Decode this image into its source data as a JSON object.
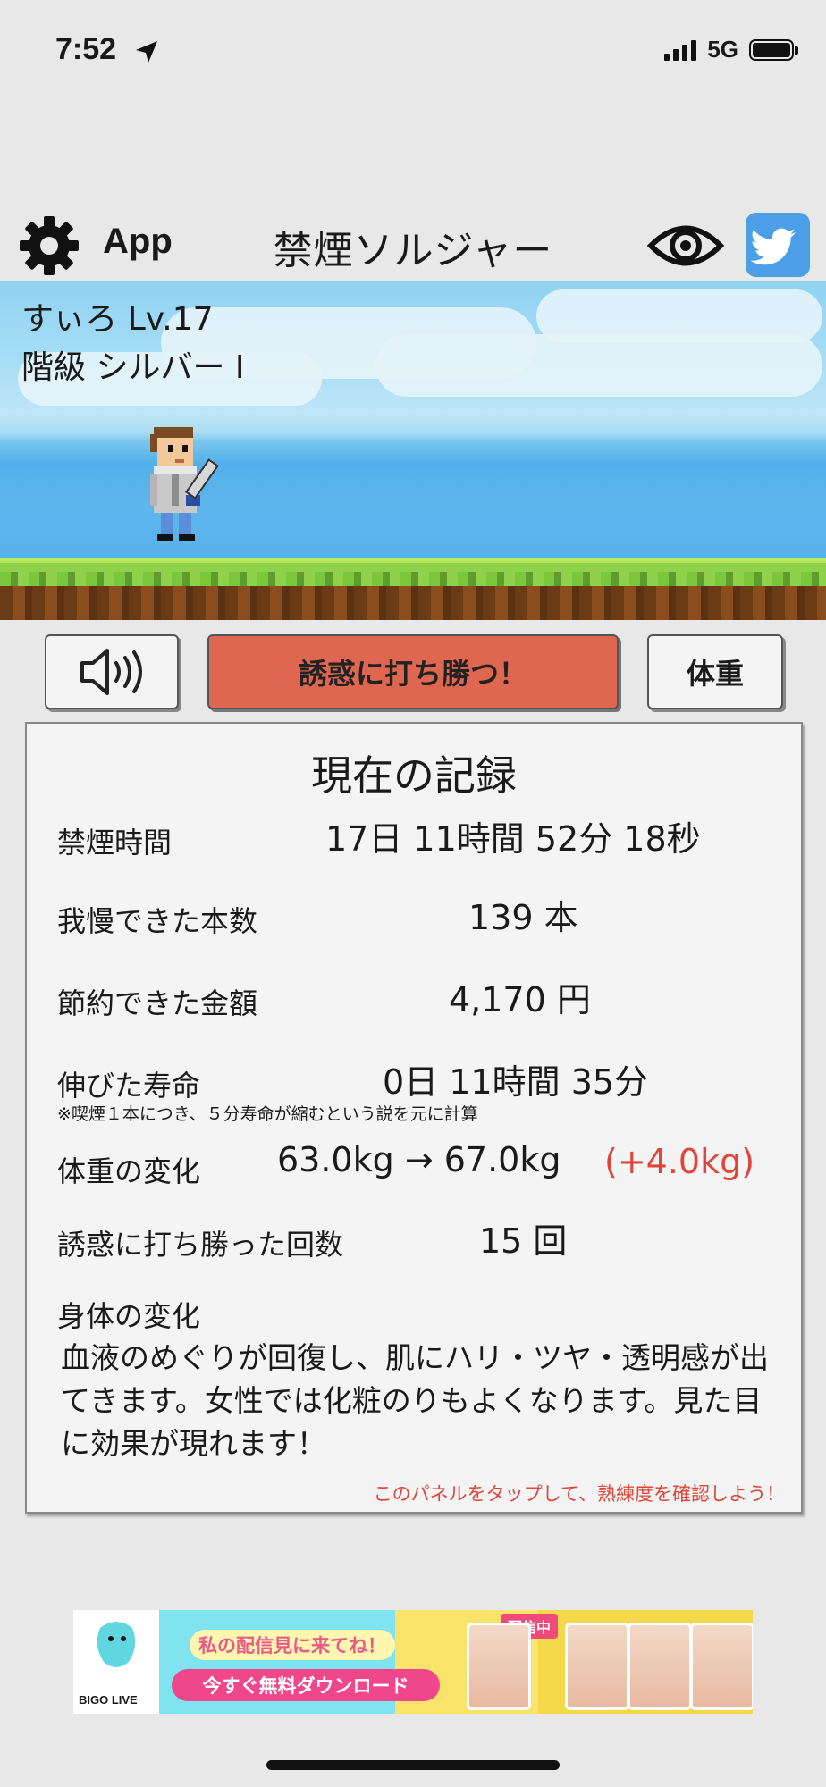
{
  "status_bar": {
    "time": "7:52",
    "network": "5G"
  },
  "header": {
    "app_label": "App",
    "title": "禁煙ソルジャー",
    "icons": [
      "gear-icon",
      "eye-icon",
      "twitter-icon"
    ],
    "twitter_color": "#4a9fe6"
  },
  "player": {
    "name": "すぃろ Lv.17",
    "rank": "階級 シルバー I"
  },
  "buttons": {
    "sound_icon": "speaker-icon",
    "resist_label": "誘惑に打ち勝つ！",
    "resist_color": "#e0674f",
    "weight_label": "体重"
  },
  "record": {
    "title": "現在の記録",
    "rows": [
      {
        "label": "禁煙時間",
        "value": "17日 11時間 52分 18秒"
      },
      {
        "label": "我慢できた本数",
        "value": "139 本"
      },
      {
        "label": "節約できた金額",
        "value": "4,170 円"
      },
      {
        "label": "伸びた寿命",
        "value": "0日 11時間 35分"
      },
      {
        "label": "体重の変化",
        "value": "63.0kg → 67.0kg",
        "delta": "(+4.0kg)"
      },
      {
        "label": "誘惑に打ち勝った回数",
        "value": "15 回"
      }
    ],
    "lifespan_note": "※喫煙１本につき、５分寿命が縮むという説を元に計算",
    "body_change_label": "身体の変化",
    "body_change_text": "血液のめぐりが回復し、肌にハリ・ツヤ・透明感が出てきます。女性では化粧のりもよくなります。見た目に効果が現れます！",
    "tap_hint": "このパネルをタップして、熟練度を確認しよう！"
  },
  "ad": {
    "brand": "BIGO LIVE",
    "line1": "私の配信見に来てね！",
    "line2": "今すぐ無料ダウンロード",
    "live_badge": "配信中"
  }
}
